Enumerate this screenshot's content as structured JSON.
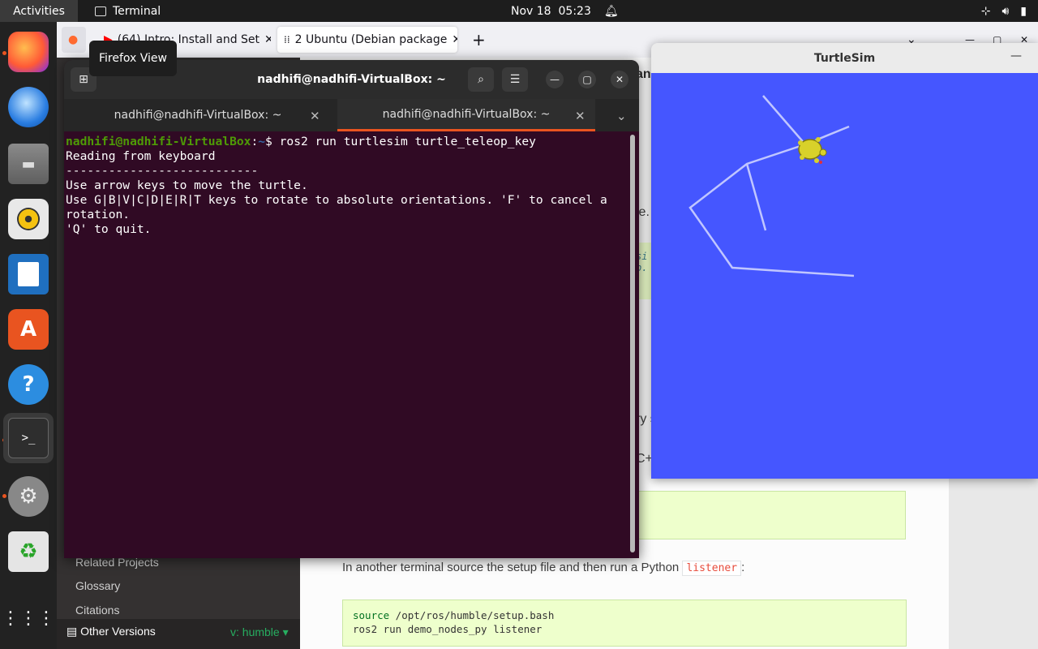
{
  "topbar": {
    "activities": "Activities",
    "app_name": "Terminal",
    "date": "Nov 18",
    "time": "05:23"
  },
  "dock": {
    "items": [
      "Firefox",
      "Thunderbird",
      "Files",
      "Rhythmbox",
      "LibreOffice Writer",
      "Ubuntu Software",
      "Help",
      "Terminal",
      "Settings",
      "Trash",
      "Show Applications"
    ]
  },
  "browser": {
    "tabs": [
      {
        "label": "(64) Intro: Install and Set"
      },
      {
        "label": "2 Ubuntu (Debian package"
      }
    ],
    "tooltip": "Firefox View",
    "sidebar": {
      "items": [
        "Related Projects",
        "Glossary",
        "Citations"
      ],
      "versions_label": "Other Versions",
      "version_value": "v: humble"
    },
    "doc": {
      "partial_1": "an",
      "partial_2": "le.",
      "partial_3": "si",
      "partial_4": "p.",
      "partial_5": "ry s",
      "partial_6": "C+",
      "listener_sentence_before": "In another terminal source the setup file and then run a Python",
      "listener_code": "listener",
      "listener_sentence_after": ":",
      "code_line_1_cmd": "source",
      "code_line_1_rest": " /opt/ros/humble/setup.bash",
      "code_line_2": "ros2 run demo_nodes_py listener"
    }
  },
  "terminal": {
    "title": "nadhifi@nadhifi-VirtualBox: ~",
    "tabs": [
      {
        "label": "nadhifi@nadhifi-VirtualBox: ~"
      },
      {
        "label": "nadhifi@nadhifi-VirtualBox: ~"
      }
    ],
    "prompt_user": "nadhifi@nadhifi-VirtualBox",
    "prompt_path": "~",
    "prompt_suffix": "$ ros2 run turtlesim turtle_teleop_key",
    "output": "Reading from keyboard\n---------------------------\nUse arrow keys to move the turtle.\nUse G|B|V|C|D|E|R|T keys to rotate to absolute orientations. 'F' to cancel a rotation.\n'Q' to quit."
  },
  "turtlesim": {
    "title": "TurtleSim",
    "background": "#4556ff"
  }
}
